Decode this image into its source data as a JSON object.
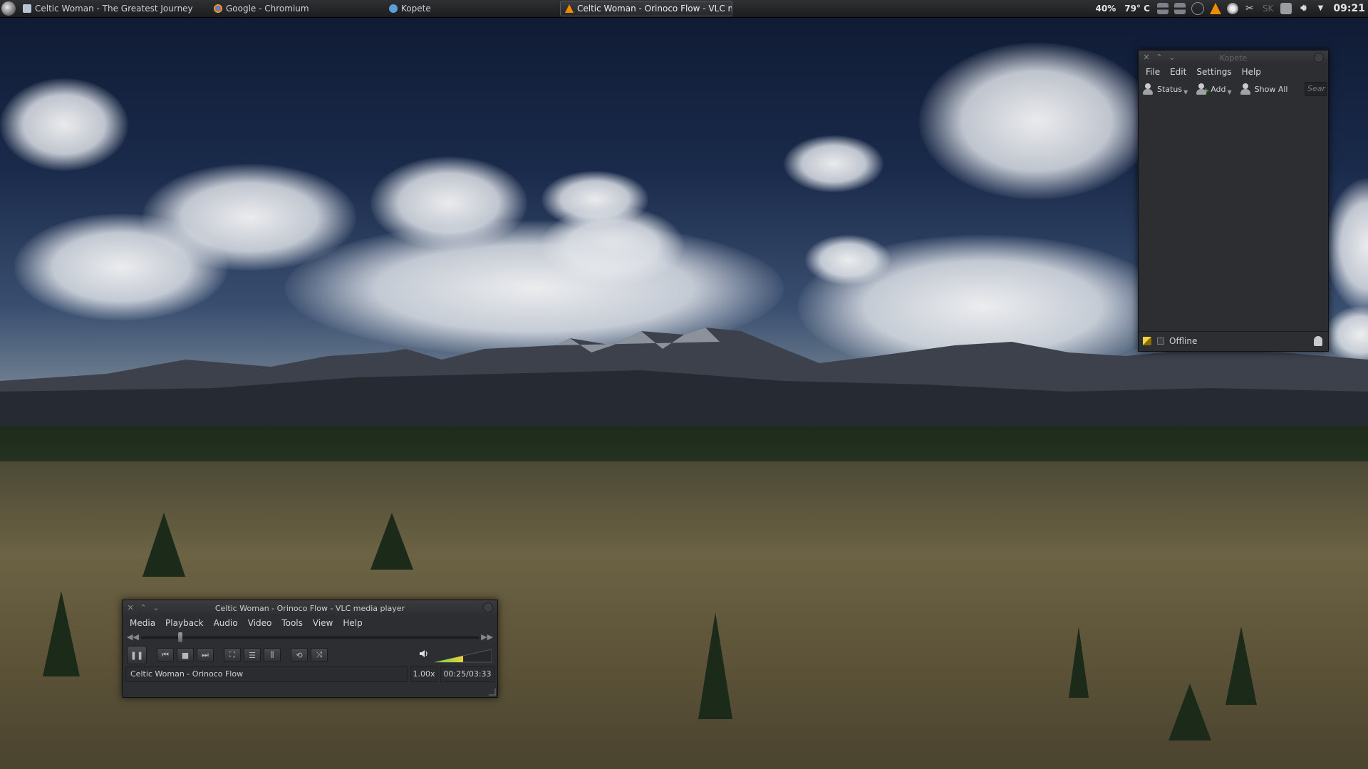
{
  "panel": {
    "tasks": [
      {
        "label": "Celtic Woman - The Greatest Journey",
        "icon": "document-icon",
        "active": false
      },
      {
        "label": "Google - Chromium",
        "icon": "chromium-icon",
        "active": false
      },
      {
        "label": "Kopete",
        "icon": "kopete-icon",
        "active": false
      },
      {
        "label": "Celtic Woman - Orinoco Flow - VLC m",
        "icon": "vlc-cone-icon",
        "active": true
      }
    ],
    "battery": "40%",
    "temperature": "79° C",
    "layout_indicator": "SK",
    "clock": "09:21"
  },
  "kopete": {
    "title": "Kopete",
    "menu": [
      {
        "label": "File"
      },
      {
        "label": "Edit"
      },
      {
        "label": "Settings"
      },
      {
        "label": "Help"
      }
    ],
    "toolbar": {
      "status": "Status",
      "add": "Add",
      "show_all": "Show All",
      "search_placeholder": "Sear"
    },
    "status_text": "Offline"
  },
  "vlc": {
    "title": "Celtic Woman - Orinoco Flow - VLC media player",
    "menu": [
      {
        "label": "Media"
      },
      {
        "label": "Playback"
      },
      {
        "label": "Audio"
      },
      {
        "label": "Video"
      },
      {
        "label": "Tools"
      },
      {
        "label": "View"
      },
      {
        "label": "Help"
      }
    ],
    "now_playing": "Celtic Woman - Orinoco Flow",
    "rate": "1.00x",
    "time": "00:25/03:33",
    "progress_fraction": 0.117,
    "volume_fraction": 0.5
  },
  "colors": {
    "vlc_orange": "#f08a00",
    "volume_green": "#6cd14b",
    "volume_yellow": "#e8d23a"
  }
}
